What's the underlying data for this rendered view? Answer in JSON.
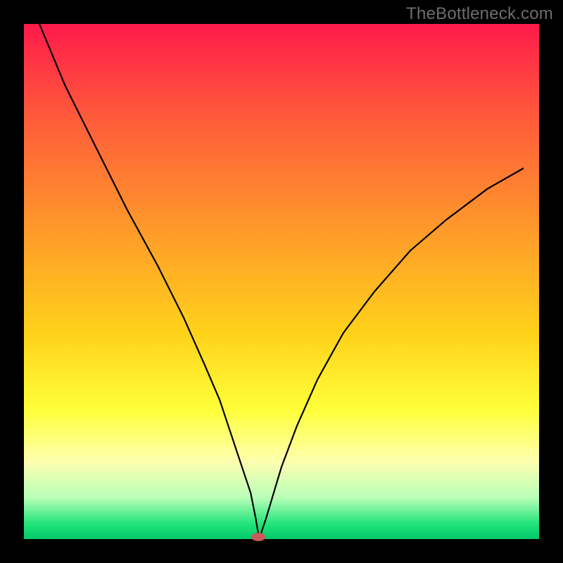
{
  "watermark": "TheBottleneck.com",
  "chart_data": {
    "type": "line",
    "title": "",
    "xlabel": "",
    "ylabel": "",
    "xlim": [
      0,
      100
    ],
    "ylim": [
      0,
      100
    ],
    "grid": false,
    "legend": false,
    "background_gradient_stops": [
      {
        "offset": 0.0,
        "color": "#ff1a4a"
      },
      {
        "offset": 0.18,
        "color": "#ff5a3a"
      },
      {
        "offset": 0.4,
        "color": "#ff9a2a"
      },
      {
        "offset": 0.6,
        "color": "#ffd21a"
      },
      {
        "offset": 0.75,
        "color": "#ffff3a"
      },
      {
        "offset": 0.85,
        "color": "#fdffb0"
      },
      {
        "offset": 0.92,
        "color": "#b8ffb8"
      },
      {
        "offset": 0.97,
        "color": "#22e57a"
      },
      {
        "offset": 1.0,
        "color": "#00c86a"
      }
    ],
    "series": [
      {
        "name": "bottleneck-curve",
        "stroke": "#000000",
        "x": [
          3.0,
          8.0,
          14.0,
          20.0,
          26.0,
          31.0,
          35.0,
          38.0,
          40.0,
          42.0,
          44.0,
          45.0,
          45.5,
          46.0,
          47.0,
          48.5,
          50.0,
          53.0,
          57.0,
          62.0,
          68.0,
          75.0,
          82.0,
          90.0,
          97.0
        ],
        "y": [
          100.0,
          88.0,
          76.0,
          64.0,
          53.0,
          43.0,
          34.0,
          27.0,
          21.0,
          15.0,
          9.0,
          4.0,
          1.0,
          1.0,
          4.0,
          9.0,
          14.0,
          22.0,
          31.0,
          40.0,
          48.0,
          56.0,
          62.0,
          68.0,
          72.0
        ]
      }
    ],
    "marker": {
      "name": "optimal-point",
      "x": 45.5,
      "y": 0.0,
      "color": "#c95a5a",
      "rx": 10,
      "ry": 6
    }
  }
}
